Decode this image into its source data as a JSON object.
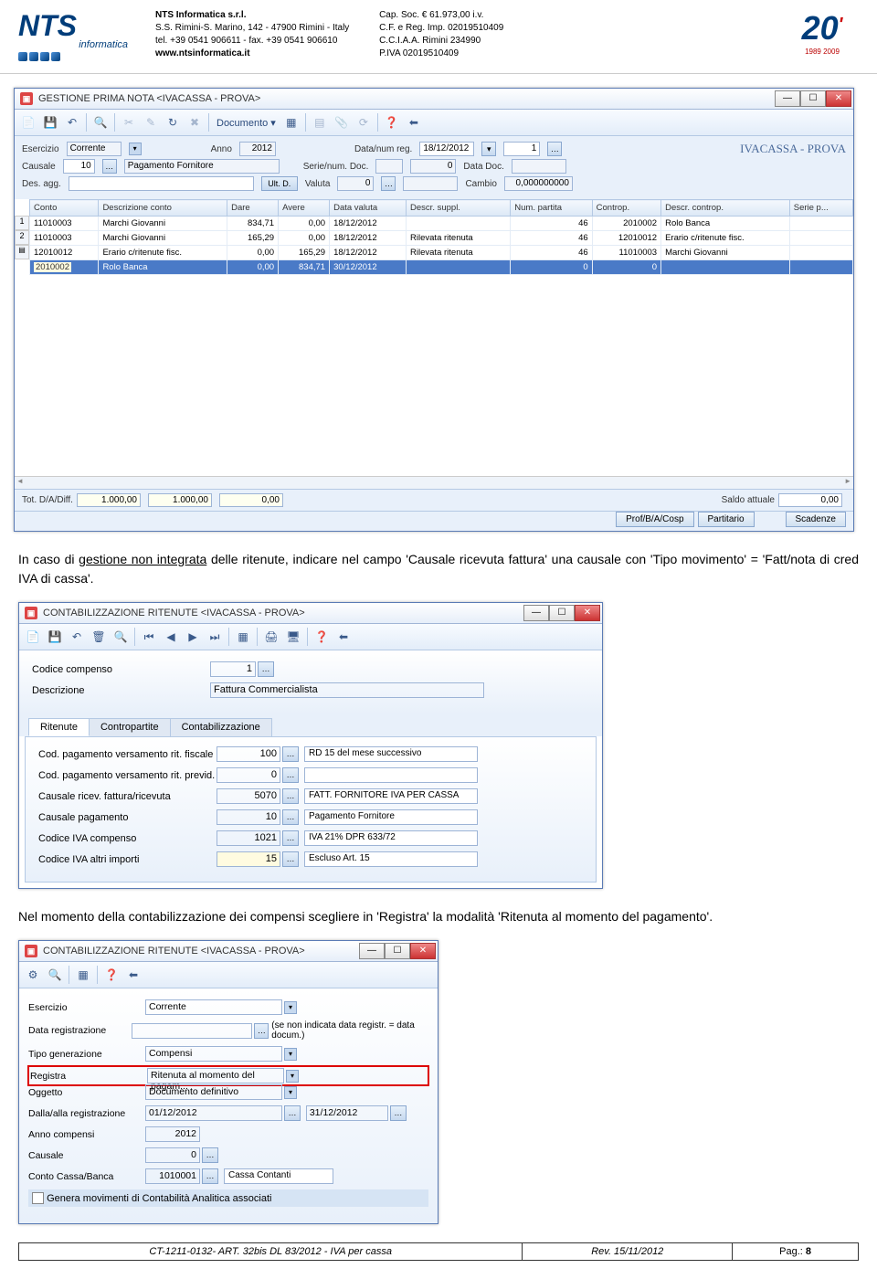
{
  "header": {
    "logo_name": "NTS",
    "logo_sub": "informatica",
    "company": {
      "name": "NTS Informatica s.r.l.",
      "addr": "S.S. Rimini-S. Marino, 142 - 47900 Rimini - Italy",
      "tel": "tel. +39 0541 906611 - fax. +39 0541 906610",
      "web": "www.ntsinformatica.it"
    },
    "legal": {
      "cap": "Cap. Soc. € 61.973,00 i.v.",
      "cf": "C.F. e Reg. Imp. 02019510409",
      "cciaa": "C.C.I.A.A. Rimini 234990",
      "piva": "P.IVA 02019510409"
    },
    "twenty": "20",
    "years": "1989 2009"
  },
  "win1": {
    "title": "GESTIONE PRIMA NOTA <IVACASSA - PROVA>",
    "docmenu": "Documento ▾",
    "brand": "IVACASSA - PROVA",
    "form": {
      "esercizio_l": "Esercizio",
      "esercizio": "Corrente",
      "anno_l": "Anno",
      "anno": "2012",
      "datanum_l": "Data/num reg.",
      "data": "18/12/2012",
      "num": "1",
      "causale_l": "Causale",
      "causale_code": "10",
      "causale_desc": "Pagamento Fornitore",
      "serienum_l": "Serie/num. Doc.",
      "serienum": "0",
      "datadoc_l": "Data Doc.",
      "desagg_l": "Des. agg.",
      "ultd": "Ult. D.",
      "valuta_l": "Valuta",
      "valuta_v": "0",
      "cambio_l": "Cambio",
      "cambio_v": "0,000000000"
    },
    "cols": [
      "Conto",
      "Descrizione conto",
      "Dare",
      "Avere",
      "Data valuta",
      "Descr. suppl.",
      "Num. partita",
      "Controp.",
      "Descr. controp.",
      "Serie p..."
    ],
    "rows": [
      {
        "c": [
          "11010003",
          "Marchi Giovanni",
          "834,71",
          "0,00",
          "18/12/2012",
          "",
          "46",
          "2010002",
          "Rolo Banca",
          ""
        ]
      },
      {
        "c": [
          "11010003",
          "Marchi Giovanni",
          "165,29",
          "0,00",
          "18/12/2012",
          "Rilevata ritenuta",
          "46",
          "12010012",
          "Erario c/ritenute fisc.",
          ""
        ]
      },
      {
        "c": [
          "12010012",
          "Erario c/ritenute fisc.",
          "0,00",
          "165,29",
          "18/12/2012",
          "Rilevata ritenuta",
          "46",
          "11010003",
          "Marchi Giovanni",
          ""
        ]
      },
      {
        "c": [
          "2010002",
          "Rolo Banca",
          "0,00",
          "834,71",
          "30/12/2012",
          "",
          "0",
          "0",
          "",
          ""
        ],
        "sel": true
      }
    ],
    "footer": {
      "tot_l": "Tot. D/A/Diff.",
      "d": "1.000,00",
      "a": "1.000,00",
      "diff": "0,00",
      "saldo_l": "Saldo attuale",
      "saldo_v": "0,00",
      "b1": "Prof/B/A/Cosp",
      "b2": "Partitario",
      "b3": "Scadenze"
    }
  },
  "para1": {
    "pre": "In caso di ",
    "u": "gestione non integrata",
    "post1": " delle ritenute, indicare nel campo 'Causale ricevuta fattura' una causale con 'Tipo movimento' = 'Fatt/nota di cred IVA di cassa'."
  },
  "win2": {
    "title": "CONTABILIZZAZIONE RITENUTE <IVACASSA - PROVA>",
    "f": {
      "cod_l": "Codice compenso",
      "cod_v": "1",
      "desc_l": "Descrizione",
      "desc_v": "Fattura Commercialista"
    },
    "tabs": {
      "t1": "Ritenute",
      "t2": "Contropartite",
      "t3": "Contabilizzazione"
    },
    "rows": [
      {
        "l": "Cod. pagamento versamento rit. fiscale",
        "v": "100",
        "d": "RD 15 del mese successivo"
      },
      {
        "l": "Cod. pagamento versamento rit. previd.",
        "v": "0",
        "d": ""
      },
      {
        "l": "Causale ricev. fattura/ricevuta",
        "v": "5070",
        "d": "FATT. FORNITORE IVA PER CASSA"
      },
      {
        "l": "Causale pagamento",
        "v": "10",
        "d": "Pagamento Fornitore"
      },
      {
        "l": "Codice IVA compenso",
        "v": "1021",
        "d": "IVA 21% DPR 633/72"
      },
      {
        "l": "Codice IVA altri importi",
        "v": "15",
        "d": "Escluso Art. 15",
        "yel": true
      }
    ]
  },
  "para2": "Nel momento della contabilizzazione dei compensi scegliere in 'Registra' la modalità 'Ritenuta al momento del pagamento'.",
  "win3": {
    "title": "CONTABILIZZAZIONE RITENUTE <IVACASSA - PROVA>",
    "rows": [
      {
        "l": "Esercizio",
        "v": "Corrente",
        "dd": true
      },
      {
        "l": "Data registrazione",
        "v": "",
        "btn": true,
        "after": "(se non indicata data registr. = data docum.)"
      },
      {
        "l": "Tipo generazione",
        "v": "Compensi",
        "dd": true
      },
      {
        "l": "Registra",
        "v": "Ritenuta al momento del pagam...",
        "dd": true,
        "hl": true
      },
      {
        "l": "Oggetto",
        "v": "Documento definitivo",
        "dd": true
      },
      {
        "l": "Dalla/alla registrazione",
        "v": "01/12/2012",
        "btn": true,
        "v2": "31/12/2012",
        "btn2": true
      },
      {
        "l": "Anno compensi",
        "v": "2012",
        "num": true
      },
      {
        "l": "Causale",
        "v": "0",
        "btn": true,
        "num": true
      },
      {
        "l": "Conto Cassa/Banca",
        "v": "1010001",
        "btn": true,
        "num": true,
        "d": "Cassa Contanti"
      }
    ],
    "chk_l": "Genera movimenti di Contabilità Analitica associati"
  },
  "footer": {
    "doc": "CT-1211-0132- ART. 32bis DL 83/2012 - IVA per cassa",
    "rev": "Rev. 15/11/2012",
    "pag_l": "Pag.: ",
    "pag_n": "8"
  }
}
